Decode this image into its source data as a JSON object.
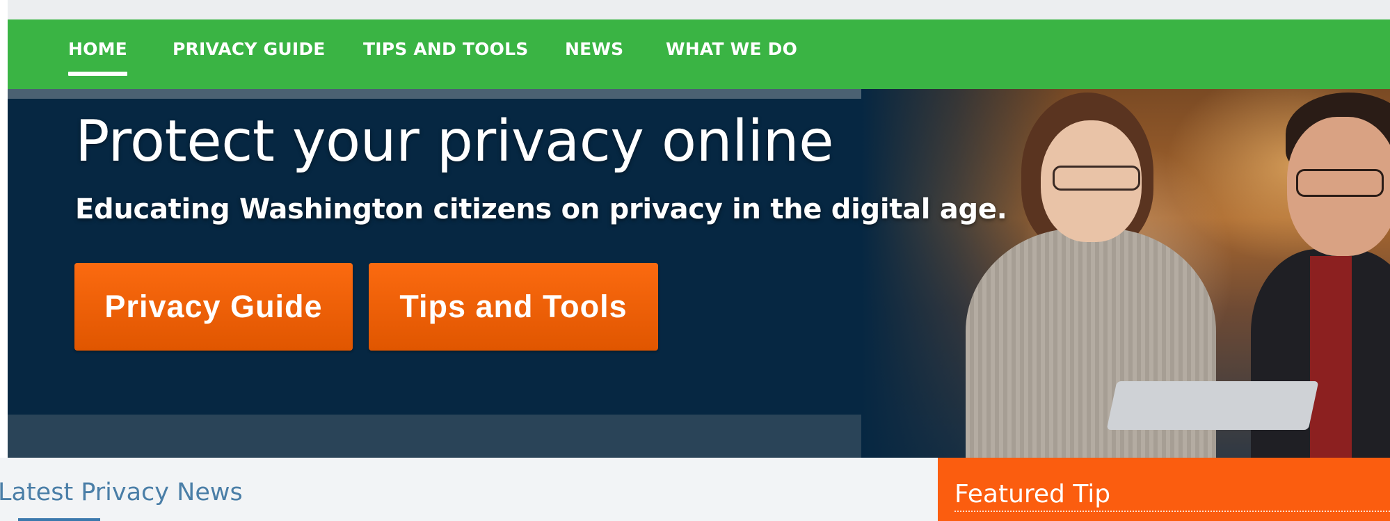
{
  "nav": {
    "items": [
      {
        "label": "HOME",
        "active": true
      },
      {
        "label": "PRIVACY GUIDE",
        "active": false
      },
      {
        "label": "TIPS AND TOOLS",
        "active": false
      },
      {
        "label": "NEWS",
        "active": false
      },
      {
        "label": "WHAT WE DO",
        "active": false
      }
    ]
  },
  "hero": {
    "title": "Protect your privacy online",
    "subtitle": "Educating Washington citizens on privacy in the digital age.",
    "buttons": {
      "privacy_guide": "Privacy Guide",
      "tips_and_tools": "Tips and Tools"
    }
  },
  "news": {
    "title": "Latest Privacy News"
  },
  "featured_tip": {
    "title": "Featured Tip"
  },
  "colors": {
    "nav_green": "#3ab444",
    "hero_navy": "#062742",
    "cta_orange": "#fb5d0f",
    "news_blue": "#4a7ea7"
  }
}
